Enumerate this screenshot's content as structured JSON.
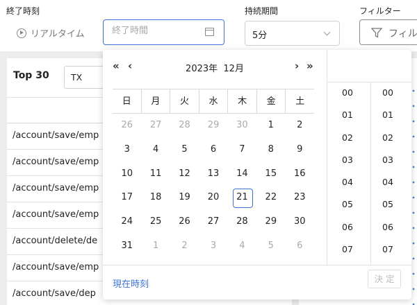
{
  "toolbar": {
    "end_time_label": "終了時刻",
    "realtime_label": "リアルタイム",
    "end_time_placeholder": "終了時間",
    "duration_label": "持続期間",
    "duration_value": "5分",
    "filter_label": "フィルター",
    "filter_button": "フィル"
  },
  "list": {
    "title": "Top 30",
    "search_value": "TX",
    "rows": [
      "/account/save/emp",
      "/account/save/emp",
      "/account/save/emp",
      "/account/save/emp",
      "/account/delete/de",
      "/account/save/emp",
      "/account/save/dep"
    ]
  },
  "calendar": {
    "nav_prev_year": "«",
    "nav_prev_month": "‹",
    "nav_next_month": "›",
    "nav_next_year": "»",
    "year": "2023年",
    "month": "12月",
    "weekdays": [
      "日",
      "月",
      "火",
      "水",
      "木",
      "金",
      "土"
    ],
    "weeks": [
      [
        "26",
        "27",
        "28",
        "29",
        "30",
        "1",
        "2"
      ],
      [
        "3",
        "4",
        "5",
        "6",
        "7",
        "8",
        "9"
      ],
      [
        "10",
        "11",
        "12",
        "13",
        "14",
        "15",
        "16"
      ],
      [
        "17",
        "18",
        "19",
        "20",
        "21",
        "22",
        "23"
      ],
      [
        "24",
        "25",
        "26",
        "27",
        "28",
        "29",
        "30"
      ],
      [
        "31",
        "1",
        "2",
        "3",
        "4",
        "5",
        "6"
      ]
    ],
    "today": "21",
    "hours": [
      "00",
      "01",
      "02",
      "03",
      "04",
      "05",
      "06",
      "07"
    ],
    "minutes": [
      "00",
      "01",
      "02",
      "03",
      "04",
      "05",
      "06",
      "07"
    ],
    "now_link": "現在時刻",
    "ok_button": "決 定",
    "accent_color": "#3d73d9"
  }
}
